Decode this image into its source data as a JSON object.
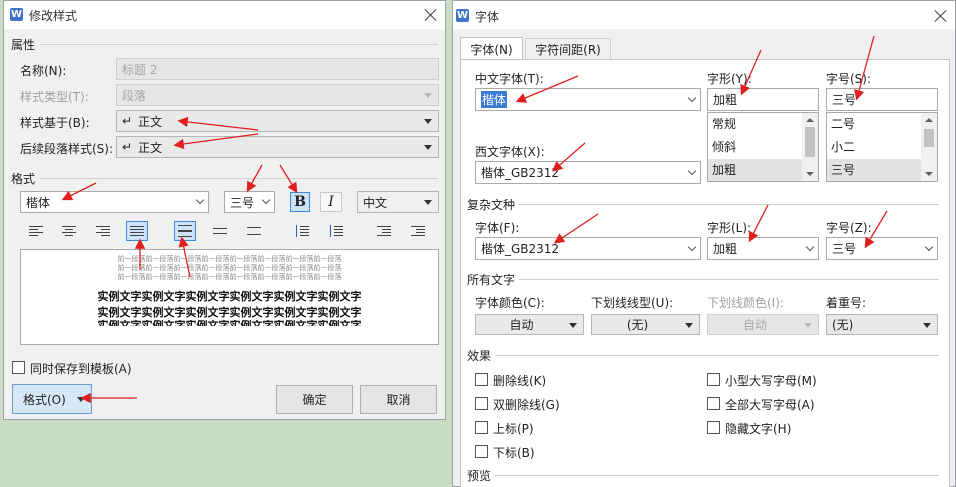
{
  "left": {
    "title": "修改样式",
    "section_props": "属性",
    "name_label": "名称(N):",
    "name_value": "标题 2",
    "type_label": "样式类型(T):",
    "type_value": "段落",
    "based_label": "样式基于(B):",
    "based_value": "正文",
    "next_label": "后续段落样式(S):",
    "next_value": "正文",
    "para_symbol": "↵",
    "section_format": "格式",
    "font_value": "楷体",
    "size_value": "三号",
    "bold_label": "B",
    "italic_label": "I",
    "lang_value": "中文",
    "preview_lines": [
      "前一段落前一段落前一段落前一段落前一段落前一段落前一段落前一段落",
      "前一段落前一段落前一段落前一段落前一段落前一段落前一段落前一段落",
      "前一段落前一段落前一段落前一段落前一段落前一段落前一段落前一段落",
      "实例文字实例文字实例文字实例文字实例文字实例文字",
      "实例文字实例文字实例文字实例文字实例文字实例文字",
      "实例文字实例文字实例文字实例文字实例文字实例文字"
    ],
    "save_template_label": "同时保存到模板(A)",
    "format_button": "格式(O)",
    "ok_button": "确定",
    "cancel_button": "取消"
  },
  "right": {
    "title": "字体",
    "tabs": [
      "字体(N)",
      "字符间距(R)"
    ],
    "cn_font_label": "中文字体(T):",
    "cn_font_value": "楷体",
    "style_label": "字形(Y):",
    "style_value": "加粗",
    "style_options": [
      "常规",
      "倾斜",
      "加粗"
    ],
    "size_label": "字号(S):",
    "size_value": "三号",
    "size_options": [
      "二号",
      "小二",
      "三号"
    ],
    "west_font_label": "西文字体(X):",
    "west_font_value": "楷体_GB2312",
    "complex_section": "复杂文种",
    "cx_font_label": "字体(F):",
    "cx_font_value": "楷体_GB2312",
    "cx_style_label": "字形(L):",
    "cx_style_value": "加粗",
    "cx_size_label": "字号(Z):",
    "cx_size_value": "三号",
    "all_text_section": "所有文字",
    "color_label": "字体颜色(C):",
    "color_value": "自动",
    "underline_label": "下划线线型(U):",
    "underline_value": "(无)",
    "ucolor_label": "下划线颜色(I):",
    "ucolor_value": "自动",
    "emph_label": "着重号:",
    "emph_value": "(无)",
    "effects_section": "效果",
    "effects_left": [
      "删除线(K)",
      "双删除线(G)",
      "上标(P)",
      "下标(B)"
    ],
    "effects_right": [
      "小型大写字母(M)",
      "全部大写字母(A)",
      "隐藏文字(H)"
    ],
    "preview_section": "预览"
  },
  "colors": {
    "annotation_arrow": "#e02020",
    "selection": "#3a7bd5",
    "desktop": "#c9dcc4"
  },
  "icons": [
    "wps-logo-icon",
    "close-icon",
    "dropdown-arrow-icon",
    "paragraph-mark-icon",
    "align-left-icon",
    "align-center-icon",
    "align-right-icon",
    "justify-icon",
    "single-spacing-icon",
    "onehalf-spacing-icon",
    "double-spacing-icon",
    "space-before-icon",
    "space-after-icon",
    "indent-decrease-icon",
    "indent-increase-icon"
  ]
}
